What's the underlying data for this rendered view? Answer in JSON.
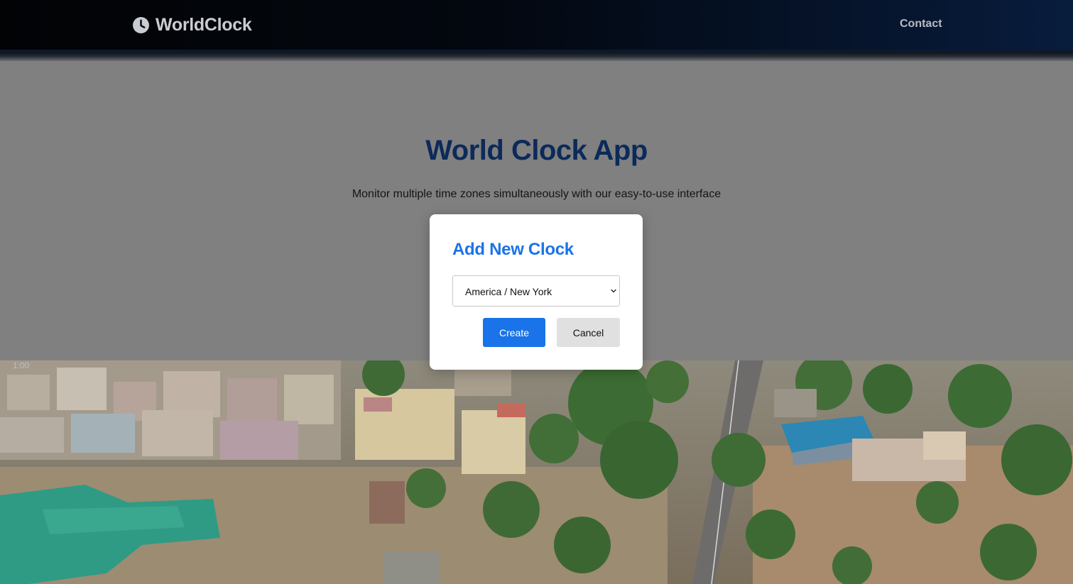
{
  "header": {
    "brand_name": "WorldClock",
    "brand_icon": "clock-icon",
    "nav_contact": "Contact"
  },
  "hero": {
    "title": "World Clock App",
    "subtitle": "Monitor multiple time zones simultaneously with our easy-to-use interface"
  },
  "video": {
    "time_label": "1:00"
  },
  "modal": {
    "title": "Add New Clock",
    "timezone_selected": "America / New York",
    "create_label": "Create",
    "cancel_label": "Cancel"
  },
  "colors": {
    "accent": "#1a73e8",
    "hero_title": "#0c2a5a",
    "overlay": "#808080"
  }
}
